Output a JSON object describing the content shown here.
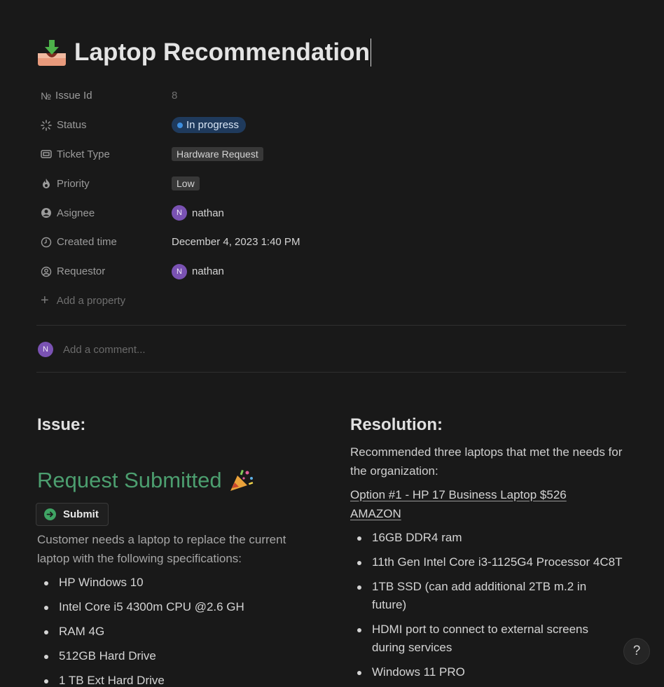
{
  "page": {
    "title": "Laptop Recommendation",
    "icon": "inbox-download-icon"
  },
  "properties": {
    "issue_id": {
      "label": "Issue Id",
      "value": "8",
      "prefix": "№"
    },
    "status": {
      "label": "Status",
      "value": "In progress",
      "color": "#3e8ede"
    },
    "ticket_type": {
      "label": "Ticket Type",
      "value": "Hardware Request"
    },
    "priority": {
      "label": "Priority",
      "value": "Low"
    },
    "assignee": {
      "label": "Asignee",
      "value": "nathan",
      "avatar_initial": "N"
    },
    "created_time": {
      "label": "Created time",
      "value": "December 4, 2023 1:40 PM"
    },
    "requestor": {
      "label": "Requestor",
      "value": "nathan",
      "avatar_initial": "N"
    },
    "add_property": "Add a property"
  },
  "comment": {
    "avatar_initial": "N",
    "placeholder": "Add a comment..."
  },
  "issue": {
    "heading": "Issue:",
    "request_title": "Request Submitted",
    "submit_label": "Submit",
    "description": "Customer needs a laptop to replace the current laptop with the following specifications:",
    "specs": [
      "HP Windows 10",
      "Intel Core i5 4300m CPU @2.6 GH",
      "RAM 4G",
      "512GB Hard Drive",
      "1 TB Ext Hard Drive"
    ]
  },
  "resolution": {
    "heading": "Resolution:",
    "description": "Recommended three laptops that met the needs for the organization:",
    "option_link": "Option #1 - HP 17 Business Laptop $526 AMAZON",
    "features": [
      "16GB DDR4 ram",
      "11th Gen Intel Core i3-1125G4 Processor 4C8T",
      "1TB SSD (can add additional 2TB m.2 in future)",
      "HDMI port to connect to external screens during services",
      "Windows 11 PRO"
    ]
  },
  "help_label": "?",
  "colors": {
    "background": "#191919",
    "status_blue": "#3e8ede",
    "request_green": "#4c9e6f",
    "avatar_purple": "#7a52b3"
  }
}
